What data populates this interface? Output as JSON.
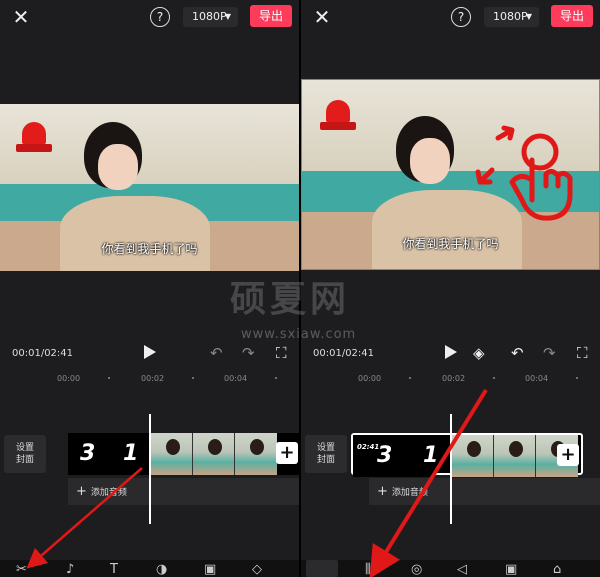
{
  "panels": [
    {
      "header": {
        "close": "✕",
        "help": "?",
        "resolution": "1080P",
        "export": "导出"
      },
      "video": {
        "subtitle": "你看到我手机了吗"
      },
      "player": {
        "time": "00:01/02:41"
      },
      "ruler": {
        "marks": [
          "00:00",
          "00:02",
          "00:04"
        ]
      },
      "timeline": {
        "cover_label": "设置\n封面",
        "count_digits": [
          "3",
          "1"
        ],
        "add_audio": "添加音频",
        "add_clip": "+"
      }
    },
    {
      "header": {
        "close": "✕",
        "help": "?",
        "resolution": "1080P",
        "export": "导出"
      },
      "video": {
        "subtitle": "你看到我手机了吗"
      },
      "player": {
        "time": "00:01/02:41"
      },
      "ruler": {
        "marks": [
          "00:00",
          "00:02",
          "00:04"
        ]
      },
      "timeline": {
        "cover_label": "设置\n封面",
        "count_digits": [
          "3",
          "1"
        ],
        "duration": "02:41",
        "add_audio": "添加音频",
        "add_clip": "+"
      }
    }
  ],
  "watermark": {
    "big": "硕夏网",
    "small": "www.sxiaw.com"
  },
  "icons": {
    "close": "close-icon",
    "help": "help-icon",
    "caret": "caret-down-icon",
    "play": "play-icon",
    "undo": "undo-icon",
    "redo": "redo-icon",
    "fullscreen": "fullscreen-icon",
    "keyframe": "keyframe-icon",
    "siren": "siren-icon",
    "hand": "tap-hand-icon"
  },
  "colors": {
    "accent": "#ff3b5c",
    "annotation": "#e01818",
    "background": "#1d1d1f"
  }
}
